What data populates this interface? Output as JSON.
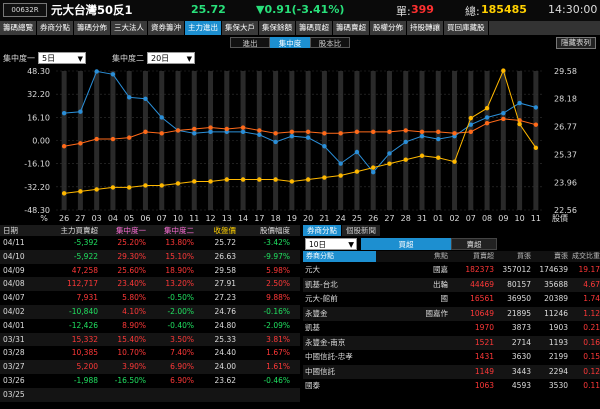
{
  "header": {
    "stock_code": "00632R",
    "stock_name": "元大台灣50反1",
    "price": "25.72",
    "change": "▼0.91(-3.41%)",
    "volume_label": "單:",
    "volume": "399",
    "total_label": "總:",
    "total": "185485",
    "time": "14:30:00"
  },
  "tabs": [
    "籌碼總覽",
    "券商分點",
    "籌碼分佈",
    "三大法人",
    "資券籌沖",
    "主力進出",
    "集保大戶",
    "集保餘額",
    "籌碼買超",
    "籌碼賣超",
    "股權分佈",
    "持股轉讓",
    "買回庫藏股"
  ],
  "active_tab": "主力進出",
  "subtabs": [
    "進出",
    "集中度",
    "股本比"
  ],
  "active_subtab": "集中度",
  "hide_button": "隱藏表列",
  "controls": {
    "c1_label": "集中度一",
    "c1_value": "5日",
    "c2_label": "集中度二",
    "c2_value": "20日"
  },
  "colors": {
    "red": "#ff3838",
    "green": "#20e060",
    "blue": "#2b8fd8",
    "orange": "#ff6a1a",
    "yellow": "#ffb800",
    "accent": "#1d8fd0"
  },
  "chart_data": {
    "type": "line",
    "x": [
      "26",
      "27",
      "03",
      "04",
      "05",
      "06",
      "07",
      "10",
      "11",
      "12",
      "13",
      "14",
      "17",
      "18",
      "19",
      "20",
      "21",
      "24",
      "25",
      "26",
      "27",
      "28",
      "31",
      "01",
      "02",
      "07",
      "08",
      "09",
      "10",
      "11"
    ],
    "left_axis": {
      "ticks": [
        "48.30",
        "32.20",
        "16.10",
        "0.00",
        "-16.10",
        "-32.20",
        "-48.30"
      ],
      "range": [
        -48.3,
        48.3
      ]
    },
    "right_axis": {
      "ticks": [
        "29.58",
        "28.18",
        "26.77",
        "25.37",
        "23.96",
        "22.56"
      ],
      "range": [
        22.56,
        29.58
      ],
      "label": "股價"
    },
    "series": [
      {
        "color": "#2b8fd8",
        "axis": "left",
        "values": [
          19,
          20,
          48,
          46,
          30,
          29,
          16,
          7,
          5,
          6,
          6,
          6,
          4,
          -1,
          3,
          2,
          -4,
          -16,
          -8,
          -22,
          -9,
          -1,
          3,
          1,
          3,
          11,
          16,
          19,
          26,
          23
        ]
      },
      {
        "color": "#ff6a1a",
        "axis": "left",
        "values": [
          -4,
          -2,
          1,
          1,
          2,
          6,
          5,
          7,
          8,
          9,
          8,
          9,
          7,
          5,
          6,
          6,
          5,
          5,
          6,
          6,
          6,
          7,
          6,
          6,
          5,
          6,
          12,
          15,
          14,
          11
        ]
      },
      {
        "color": "#ffb800",
        "axis": "right",
        "values": [
          23.4,
          23.5,
          23.6,
          23.7,
          23.7,
          23.8,
          23.8,
          23.9,
          24.0,
          24.0,
          24.1,
          24.1,
          24.1,
          24.1,
          24.0,
          24.1,
          24.2,
          24.3,
          24.5,
          24.7,
          24.9,
          25.1,
          25.3,
          25.2,
          25.0,
          27.2,
          27.7,
          29.6,
          26.9,
          25.7
        ]
      }
    ]
  },
  "table": {
    "headers": [
      "日期",
      "主力買賣超",
      "集中度一",
      "集中度二",
      "收盤價",
      "股價幅度"
    ],
    "rows": [
      [
        "04/11",
        "-5,392",
        "25.20%",
        "13.80%",
        "25.72",
        "-3.42%"
      ],
      [
        "04/10",
        "-5,922",
        "29.30%",
        "15.10%",
        "26.63",
        "-9.97%"
      ],
      [
        "04/09",
        "47,258",
        "25.60%",
        "18.90%",
        "29.58",
        "5.98%"
      ],
      [
        "04/08",
        "112,717",
        "23.40%",
        "13.20%",
        "27.91",
        "2.50%"
      ],
      [
        "04/07",
        "7,931",
        "5.80%",
        "-0.50%",
        "27.23",
        "9.88%"
      ],
      [
        "04/02",
        "-10,840",
        "4.10%",
        "-2.00%",
        "24.76",
        "-0.16%"
      ],
      [
        "04/01",
        "-12,426",
        "8.90%",
        "-0.40%",
        "24.80",
        "-2.09%"
      ],
      [
        "03/31",
        "15,332",
        "15.40%",
        "3.50%",
        "25.33",
        "3.81%"
      ],
      [
        "03/28",
        "10,385",
        "10.70%",
        "7.40%",
        "24.40",
        "1.67%"
      ],
      [
        "03/27",
        "5,200",
        "3.90%",
        "6.90%",
        "24.00",
        "1.61%"
      ],
      [
        "03/26",
        "-1,988",
        "-16.50%",
        "6.90%",
        "23.62",
        "-0.46%"
      ],
      [
        "03/25",
        "",
        "",
        "",
        "",
        ""
      ]
    ]
  },
  "right_panel": {
    "tabs": [
      "券商分點",
      "個股新聞"
    ],
    "period": "10日",
    "buysell_tabs": [
      "買超",
      "賣超"
    ],
    "headers": [
      "券商分點",
      "焦點",
      "買賣超",
      "買張",
      "賣張",
      "成交比重"
    ],
    "rows": [
      [
        "元大",
        "國嘉",
        "182373",
        "357012",
        "174639",
        "19.17"
      ],
      [
        "凱基-台北",
        "出輪",
        "44469",
        "80157",
        "35688",
        "4.67"
      ],
      [
        "元大-館前",
        "國",
        "16561",
        "36950",
        "20389",
        "1.74"
      ],
      [
        "永豐金",
        "國嘉作",
        "10649",
        "21895",
        "11246",
        "1.12"
      ],
      [
        "凱基",
        "",
        "1970",
        "3873",
        "1903",
        "0.21"
      ],
      [
        "永豐金-南京",
        "",
        "1521",
        "2714",
        "1193",
        "0.16"
      ],
      [
        "中國信託-忠孝",
        "",
        "1431",
        "3630",
        "2199",
        "0.15"
      ],
      [
        "中國信託",
        "",
        "1149",
        "3443",
        "2294",
        "0.12"
      ],
      [
        "國泰",
        "",
        "1063",
        "4593",
        "3530",
        "0.11"
      ]
    ]
  }
}
